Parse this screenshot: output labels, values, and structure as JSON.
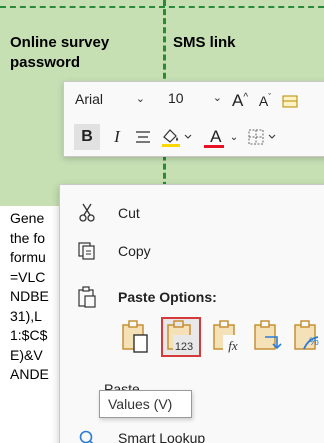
{
  "sheet": {
    "col_a_header": "Online survey password",
    "col_b_header": "SMS link",
    "cell_text": "Gene\nthe fo\nformu\n=VLC\nNDBE\n31),L\n1:$C$\nE)&V\nANDE"
  },
  "mini_toolbar": {
    "font_name": "Arial",
    "font_size": "10",
    "bold_label": "B",
    "italic_label": "I",
    "grow_font_label": "A",
    "shrink_font_label": "A",
    "font_color_label": "A",
    "font_color": "#e81123",
    "fill_color": "#ffd800"
  },
  "context_menu": {
    "cut_label": "Cut",
    "copy_label": "Copy",
    "paste_options_label": "Paste Options:",
    "paste_special_label": "Paste",
    "smart_lookup_label": "Smart Lookup",
    "paste_icons": [
      "paste-icon",
      "paste-values-icon",
      "paste-formulas-icon",
      "paste-transpose-icon",
      "paste-formatting-icon"
    ],
    "values_icon_text": "123",
    "formulas_icon_text": "fx"
  },
  "tooltip": {
    "text": "Values (V)"
  },
  "colors": {
    "header_band": "#c6e0b4",
    "border_dashed": "#2a8a3a",
    "highlight": "#d43a3a",
    "icon_accent": "#2b7cd3",
    "clipboard": "#c38a2a"
  }
}
